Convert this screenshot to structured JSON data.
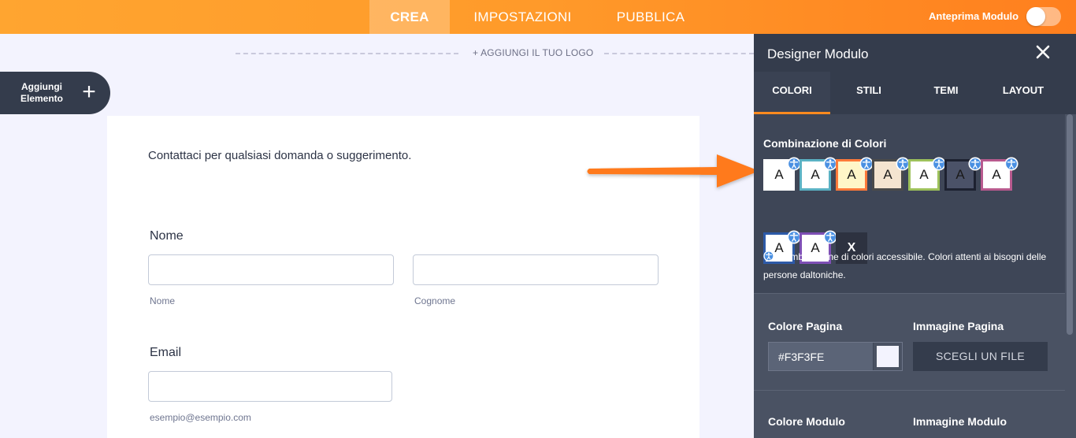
{
  "topbar": {
    "tabs": [
      "CREA",
      "IMPOSTAZIONI",
      "PUBBLICA"
    ],
    "preview_label": "Anteprima Modulo",
    "preview_on": false,
    "color": "#ff9a2a"
  },
  "canvas": {
    "logo_text": "+ AGGIUNGI IL TUO LOGO",
    "add_element_label": "Aggiungi Elemento",
    "add_element_icon": "plus-icon"
  },
  "form": {
    "description": "Contattaci per qualsiasi domanda o suggerimento.",
    "name_label": "Nome",
    "first_sublabel": "Nome",
    "last_sublabel": "Cognome",
    "email_label": "Email",
    "email_sublabel": "esempio@esempio.com"
  },
  "panel": {
    "title": "Designer Modulo",
    "close_icon": "close-icon",
    "tabs": [
      "COLORI",
      "STILI",
      "TEMI",
      "LAYOUT"
    ],
    "active_tab": "COLORI",
    "scheme_title": "Combinazione di Colori",
    "swatch_letter": "A",
    "swatches": [
      {
        "bg": "#ffffff",
        "border": "#ffffff",
        "accessible": true
      },
      {
        "bg": "#ffffff",
        "border": "#5bb2c4",
        "accessible": true
      },
      {
        "bg": "#fff6c8",
        "border": "#ff7a3a",
        "accessible": true
      },
      {
        "bg": "#f4e4d0",
        "border": "#4a4a4a",
        "accessible": true
      },
      {
        "bg": "#ffffff",
        "border": "#9dc15b",
        "accessible": true
      },
      {
        "bg": "#4b5268",
        "border": "#1d2130",
        "accessible": true
      },
      {
        "bg": "#ffffff",
        "border": "#b85a8e",
        "accessible": true
      },
      {
        "bg": "#ffffff",
        "border": "#2d5aa8",
        "accessible": true
      },
      {
        "bg": "#ffffff",
        "border": "#7e4fb5",
        "accessible": true
      }
    ],
    "clear_swatch": "X",
    "accessible_note": "Combinazione di colori accessibile. Colori attenti ai bisogni delle persone daltoniche.",
    "page_color_label": "Colore Pagina",
    "page_image_label": "Immagine Pagina",
    "page_color_value": "#F3F3FE",
    "choose_file_label": "SCEGLI UN FILE",
    "form_color_label": "Colore Modulo",
    "form_image_label": "Immagine Modulo"
  }
}
